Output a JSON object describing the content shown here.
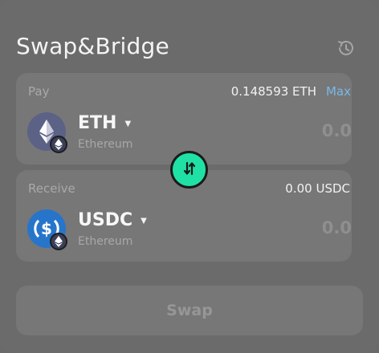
{
  "header": {
    "title": "Swap&Bridge",
    "history_icon": "history-clock-icon"
  },
  "pay": {
    "label": "Pay",
    "balance": "0.148593 ETH",
    "max_label": "Max",
    "token": {
      "symbol": "ETH",
      "network": "Ethereum",
      "icon": "ethereum-icon",
      "chain_icon": "ethereum-chain-icon"
    },
    "amount_placeholder": "0.0"
  },
  "switch": {
    "icon": "swap-vertical-arrows-icon",
    "color": "#20e1a5"
  },
  "receive": {
    "label": "Receive",
    "balance": "0.00 USDC",
    "token": {
      "symbol": "USDC",
      "network": "Ethereum",
      "icon": "usdc-icon",
      "chain_icon": "ethereum-chain-icon"
    },
    "amount_placeholder": "0.0"
  },
  "actions": {
    "swap_label": "Swap"
  },
  "colors": {
    "accent_link": "#7ab8e6",
    "switch_button": "#20e1a5",
    "usdc_blue": "#2775ca",
    "eth_circle": "#627eea"
  }
}
